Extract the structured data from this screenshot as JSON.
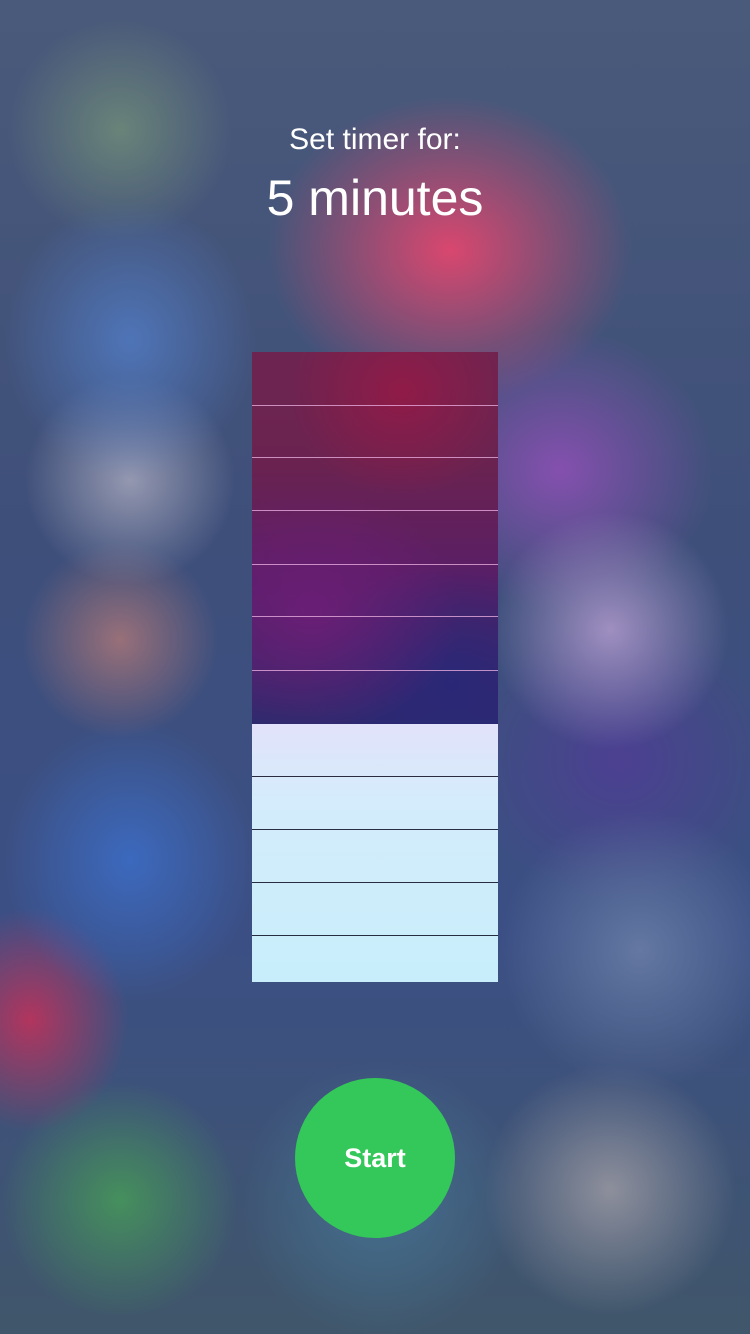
{
  "header": {
    "subtitle": "Set timer for:",
    "value": "5 minutes"
  },
  "timer_slider": {
    "total_segments": 12,
    "filled_segments": 5,
    "fill_fraction": 0.41
  },
  "start_button": {
    "label": "Start",
    "color": "#34c759"
  },
  "colors": {
    "text": "#ffffff",
    "slider_empty": "#6a2350",
    "slider_filled": "#cdeefb"
  }
}
